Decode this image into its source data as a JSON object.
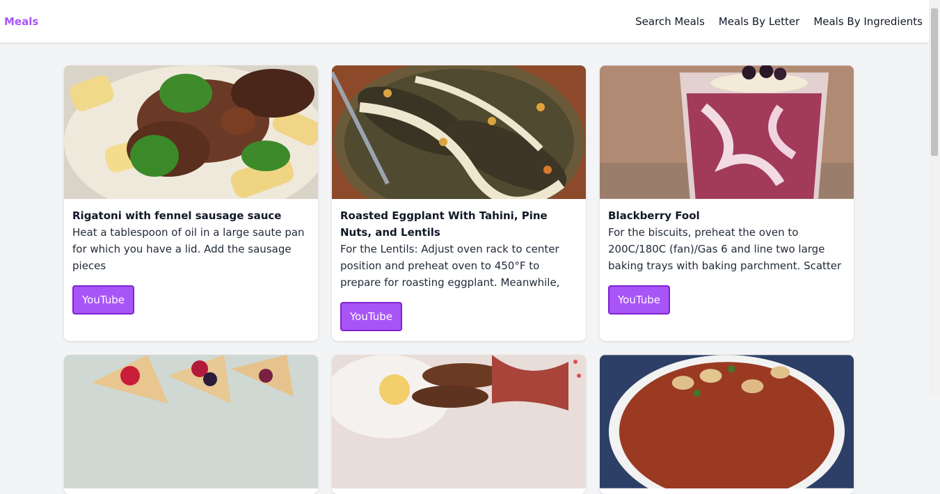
{
  "nav": {
    "brand": "Meals",
    "links": [
      "Search Meals",
      "Meals By Letter",
      "Meals By Ingredients"
    ]
  },
  "meals": [
    {
      "title": "Rigatoni with fennel sausage sauce",
      "description": "Heat a tablespoon of oil in a large saute pan for which you have a lid. Add the sausage pieces",
      "button": "YouTube",
      "image_icon": "pasta-dish-image"
    },
    {
      "title": "Roasted Eggplant With Tahini, Pine Nuts, and Lentils",
      "description": "For the Lentils: Adjust oven rack to center position and preheat oven to 450°F to prepare for roasting eggplant. Meanwhile,",
      "button": "YouTube",
      "image_icon": "eggplant-dish-image"
    },
    {
      "title": "Blackberry Fool",
      "description": "For the biscuits, preheat the oven to 200C/180C (fan)/Gas 6 and line two large baking trays with baking parchment. Scatter",
      "button": "YouTube",
      "image_icon": "dessert-glass-image"
    }
  ],
  "colors": {
    "accent": "#a855f7",
    "background": "#f3f4f6"
  }
}
